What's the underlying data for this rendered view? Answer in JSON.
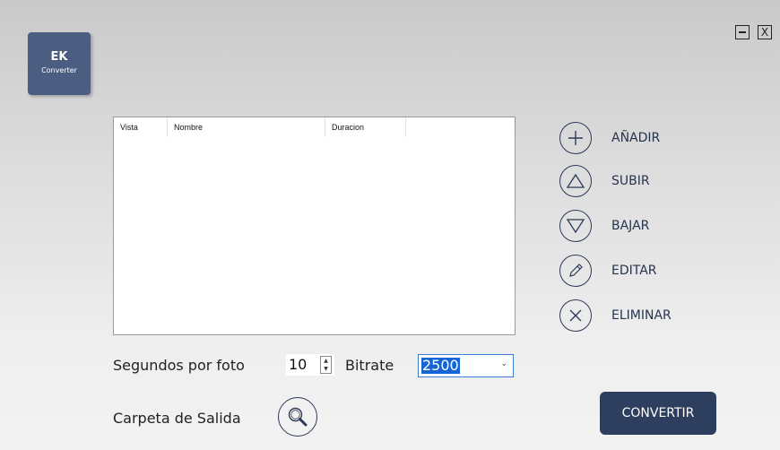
{
  "logo": {
    "title": "EK",
    "subtitle": "Converter"
  },
  "window_controls": {
    "minimize_icon": "minimize-icon",
    "close_label": "X"
  },
  "list": {
    "columns": [
      "Vista",
      "Nombre",
      "Duracion"
    ],
    "rows": []
  },
  "actions": [
    {
      "label": "AÑADIR",
      "icon": "plus-icon"
    },
    {
      "label": "SUBIR",
      "icon": "triangle-up-icon"
    },
    {
      "label": "BAJAR",
      "icon": "triangle-down-icon"
    },
    {
      "label": "EDITAR",
      "icon": "pencil-icon"
    },
    {
      "label": "ELIMINAR",
      "icon": "x-icon"
    }
  ],
  "settings": {
    "seconds_label": "Segundos por foto",
    "seconds_value": "10",
    "bitrate_label": "Bitrate",
    "bitrate_value": "2500",
    "output_folder_label": "Carpeta de Salida"
  },
  "convert_label": "CONVERTIR",
  "colors": {
    "accent": "#2d3e5f",
    "logo_bg": "#4b5d80",
    "selection": "#1665d7"
  }
}
